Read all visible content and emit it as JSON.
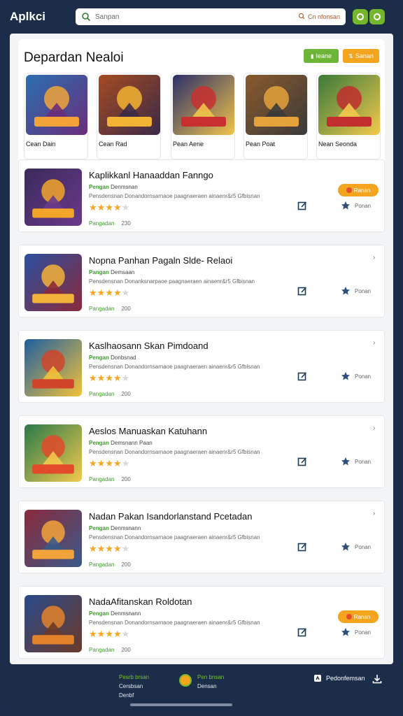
{
  "topbar": {
    "brand": "Aplkci",
    "search_placeholder": "Sanpan",
    "search_right": "Cn nfonsan"
  },
  "section": {
    "title": "Depardan Nealoi",
    "btn_green": "Ieane",
    "btn_orange": "Sanan"
  },
  "featured": [
    {
      "name": "Cean Dain",
      "palette": [
        "#2a6fb0",
        "#f1a33a",
        "#6a2d7a"
      ]
    },
    {
      "name": "Cean Rad",
      "palette": [
        "#a54b21",
        "#f2b233",
        "#3a2a48"
      ]
    },
    {
      "name": "Pean Aene",
      "palette": [
        "#2b2f6b",
        "#c7302f",
        "#f1c44a"
      ]
    },
    {
      "name": "Pean Poat",
      "palette": [
        "#8a5a2c",
        "#e3a23a",
        "#3a3a3a"
      ]
    },
    {
      "name": "Nean Seonda",
      "palette": [
        "#3a7a3a",
        "#c02e2e",
        "#f2c94c"
      ]
    }
  ],
  "apps": [
    {
      "title": "Kaplikkanl Hanaaddan Fanngo",
      "meta_g": "Pengan",
      "meta": "Denmsnan",
      "desc": "Pensdensnan Donandornsarnaoe paagnaeraen ainaenr&r5 Gfbisnan",
      "stars": 4,
      "cat": "Pangadan",
      "num": "230",
      "fav": "Ponan",
      "badge": "Ranan",
      "chev": "",
      "palette": [
        "#3a2a5a",
        "#f2a52a",
        "#6a3a8a"
      ]
    },
    {
      "title": "Nopna Panhan Pagaln Slde- Relaoi",
      "meta_g": "Pangan",
      "meta": "Demsaan",
      "desc": "Pensdensnan Donanksnarpaoe paagnaeraen ainaenr&r5 Gfbisnan",
      "stars": 4,
      "cat": "Pangadan",
      "num": "200",
      "fav": "Ponan",
      "badge": "",
      "chev": "›",
      "palette": [
        "#2a4fa0",
        "#f2b23a",
        "#8a2a3a"
      ]
    },
    {
      "title": "Kaslhaosann Skan Pimdoand",
      "meta_g": "Pengan",
      "meta": "Donbsnad",
      "desc": "Pensdensnan Donandornsarnaoe paagnaeraen ainaenr&r5 Gfbisnan",
      "stars": 4,
      "cat": "Pangadan",
      "num": "200",
      "fav": "Ponan",
      "badge": "",
      "chev": "›",
      "palette": [
        "#1e5fa0",
        "#d0452a",
        "#f2c23a"
      ]
    },
    {
      "title": "Aeslos Manuaskan Katuhann",
      "meta_g": "Pengan",
      "meta": "Demsnann Paan",
      "desc": "Pensdensnan Donandornsarnaoe paagnaeraen ainaenr&r5 Gfbisnan",
      "stars": 4,
      "cat": "Pangadan",
      "num": "200",
      "fav": "Ponan",
      "badge": "",
      "chev": "›",
      "palette": [
        "#2a7a4a",
        "#e24a2a",
        "#f2c94c"
      ]
    },
    {
      "title": "Nadan Pakan Isandorlanstand Pcetadan",
      "meta_g": "Pengan",
      "meta": "Denmsnann",
      "desc": "Pensdensnan Donandornsarnaoe paagnaeraen ainaenr&r5 Gfbisnan",
      "stars": 4,
      "cat": "Pangadan",
      "num": "200",
      "fav": "Ponan",
      "badge": "",
      "chev": "›",
      "palette": [
        "#8a2a3a",
        "#f2a33a",
        "#3a5a8a"
      ]
    },
    {
      "title": "NadaAfitanskan Roldotan",
      "meta_g": "Pengan",
      "meta": "Denmsnann",
      "desc": "Pensdensnan Donandornsarnaoe paagnaeraen ainaenr&r5 Gfbisnan",
      "stars": 4,
      "cat": "Pangadan",
      "num": "200",
      "fav": "Ponan",
      "badge": "Ranan",
      "chev": "",
      "palette": [
        "#2a4a8a",
        "#e2822a",
        "#6a3a2a"
      ]
    }
  ],
  "bottombar": {
    "c1_a": "Pesrb brsan",
    "c1_b": "Cersbsan",
    "c1_c": "Denbf",
    "c2_a": "Pen bnsan",
    "c2_b": "Densan",
    "right": "Pedonfemsan"
  }
}
